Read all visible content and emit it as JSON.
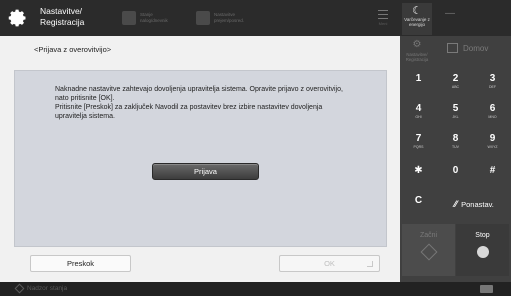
{
  "header": {
    "title_line1": "Nastavitve/",
    "title_line2": "Registracija",
    "btn1_label": "Stanje nalog/dnevnik",
    "btn2_label": "Nastavitve prejem/posred.",
    "menu_label": "Meni",
    "energy_label": "Varčevanje z energijo"
  },
  "main": {
    "breadcrumb": "<Prijava z overovitvijo>",
    "message_line1": "Naknadne nastavitve zahtevajo dovoljenja upravitelja sistema. Opravite prijavo z overovitvijo,",
    "message_line2": "nato pritisnite [OK].",
    "message_line3": "Pritisnite [Preskok] za zaključek Navodil za postavitev brez izbire nastavitev dovoljenja",
    "message_line4": "upravitelja sistema.",
    "login_button": "Prijava",
    "skip_button": "Preskok",
    "ok_button": "OK"
  },
  "right_panel": {
    "settings_label": "Nastavitve/ Registracija",
    "home_label": "Domov",
    "keys": [
      {
        "digit": "1",
        "letters": ""
      },
      {
        "digit": "2",
        "letters": "ABC"
      },
      {
        "digit": "3",
        "letters": "DEF"
      },
      {
        "digit": "4",
        "letters": "GHI"
      },
      {
        "digit": "5",
        "letters": "JKL"
      },
      {
        "digit": "6",
        "letters": "MNO"
      },
      {
        "digit": "7",
        "letters": "PQRS"
      },
      {
        "digit": "8",
        "letters": "TUV"
      },
      {
        "digit": "9",
        "letters": "WXYZ"
      },
      {
        "digit": "✱",
        "letters": ""
      },
      {
        "digit": "0",
        "letters": ""
      },
      {
        "digit": "#",
        "letters": ""
      }
    ],
    "clear_key": "C",
    "reset_label": "Ponastav.",
    "start_label": "Začni",
    "stop_label": "Stop"
  },
  "status_bar": {
    "text": "Nadzor stanja"
  }
}
